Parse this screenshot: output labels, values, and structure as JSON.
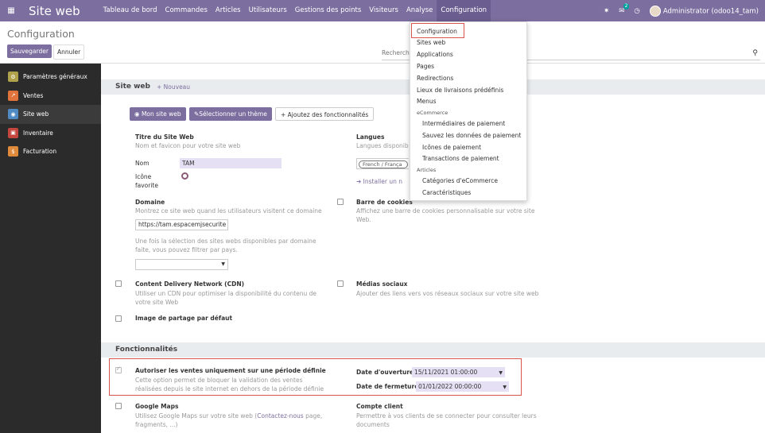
{
  "topbar": {
    "app_title": "Site web",
    "menu": [
      "Tableau de bord",
      "Commandes",
      "Articles",
      "Utilisateurs",
      "Gestions des points",
      "Visiteurs",
      "Analyse",
      "Configuration"
    ],
    "chat_badge": "2",
    "user": "Administrator (odoo14_tam)"
  },
  "control": {
    "breadcrumb": "Configuration",
    "save_label": "Sauvegarder",
    "discard_label": "Annuler",
    "search_placeholder": "Recherch"
  },
  "sidebar": {
    "items": [
      {
        "label": "Paramètres généraux",
        "color": "#b0a24a"
      },
      {
        "label": "Ventes",
        "color": "#e0743c"
      },
      {
        "label": "Site web",
        "color": "#4f8ac2"
      },
      {
        "label": "Inventaire",
        "color": "#c4463f"
      },
      {
        "label": "Facturation",
        "color": "#e08a3c"
      }
    ]
  },
  "dropdown": {
    "items": [
      {
        "label": "Configuration",
        "type": "item"
      },
      {
        "label": "Sites web",
        "type": "item"
      },
      {
        "label": "Applications",
        "type": "item"
      },
      {
        "label": "Pages",
        "type": "item"
      },
      {
        "label": "Redirections",
        "type": "item"
      },
      {
        "label": "Lieux de livraisons prédéfinis",
        "type": "item"
      },
      {
        "label": "Menus",
        "type": "item"
      },
      {
        "label": "eCommerce",
        "type": "header"
      },
      {
        "label": "Intermédiaires de paiement",
        "type": "sub"
      },
      {
        "label": "Sauvez les données de paiement",
        "type": "sub"
      },
      {
        "label": "Icônes de paiement",
        "type": "sub"
      },
      {
        "label": "Transactions de paiement",
        "type": "sub"
      },
      {
        "label": "Articles",
        "type": "header"
      },
      {
        "label": "Catégories d'eCommerce",
        "type": "sub"
      },
      {
        "label": "Caractéristiques",
        "type": "sub"
      }
    ]
  },
  "website_section": {
    "title": "Site web",
    "new_label": "Nouveau",
    "btn_my_site": "Mon site web",
    "btn_theme": "Sélectionner un thème",
    "btn_features": "Ajoutez des fonctionnalités",
    "title_label": "Titre du Site Web",
    "title_help": "Nom et favicon pour votre site web",
    "name_label": "Nom",
    "name_value": "TAM",
    "favicon_label_1": "Icône",
    "favicon_label_2": "favorite",
    "languages_label": "Langues",
    "languages_help": "Langues disponib",
    "language_tag": "French / França",
    "install_link": "Installer un n",
    "domain_label": "Domaine",
    "domain_help": "Montrez ce site web quand les utilisateurs visitent ce domaine",
    "domain_value": "https://tam.espacemjsecurite",
    "domain_help_2_line1": "Une fois la sélection des sites webs disponibles par domaine",
    "domain_help_2_line2": "faite, vous pouvez filtrer par pays.",
    "cookies_label": "Barre de cookies",
    "cookies_help_line1": "Affichez une barre de cookies personnalisable sur votre site",
    "cookies_help_line2": "Web.",
    "cdn_label": "Content Delivery Network (CDN)",
    "cdn_help_line1": "Utiliser un CDN pour optimiser la disponibilité du contenu de",
    "cdn_help_line2": "votre site Web",
    "social_label": "Médias sociaux",
    "social_help": "Ajouter des liens vers vos réseaux sociaux sur votre site web",
    "share_image_label": "Image de partage par défaut"
  },
  "features_section": {
    "title": "Fonctionnalités",
    "period_label": "Autoriser les ventes uniquement sur une période définie",
    "period_help_line1": "Cette option permet de bloquer la validation des ventes",
    "period_help_line2": "réalisées depuis le site internet en dehors de la période définie",
    "open_date_label": "Date d'ouverture",
    "open_date_value": "15/11/2021 01:00:00",
    "close_date_label": "Date de fermeture",
    "close_date_value": "01/01/2022 00:00:00",
    "maps_label": "Google Maps",
    "maps_help_pre": "Utilisez Google Maps sur votre site web (",
    "maps_help_link": "Contactez-nous",
    "maps_help_post": " page,",
    "maps_help_line2": "fragments, ...)",
    "account_label": "Compte client",
    "account_help_line1": "Permettre à vos clients de se connecter pour consulter leurs",
    "account_help_line2": "documents"
  }
}
